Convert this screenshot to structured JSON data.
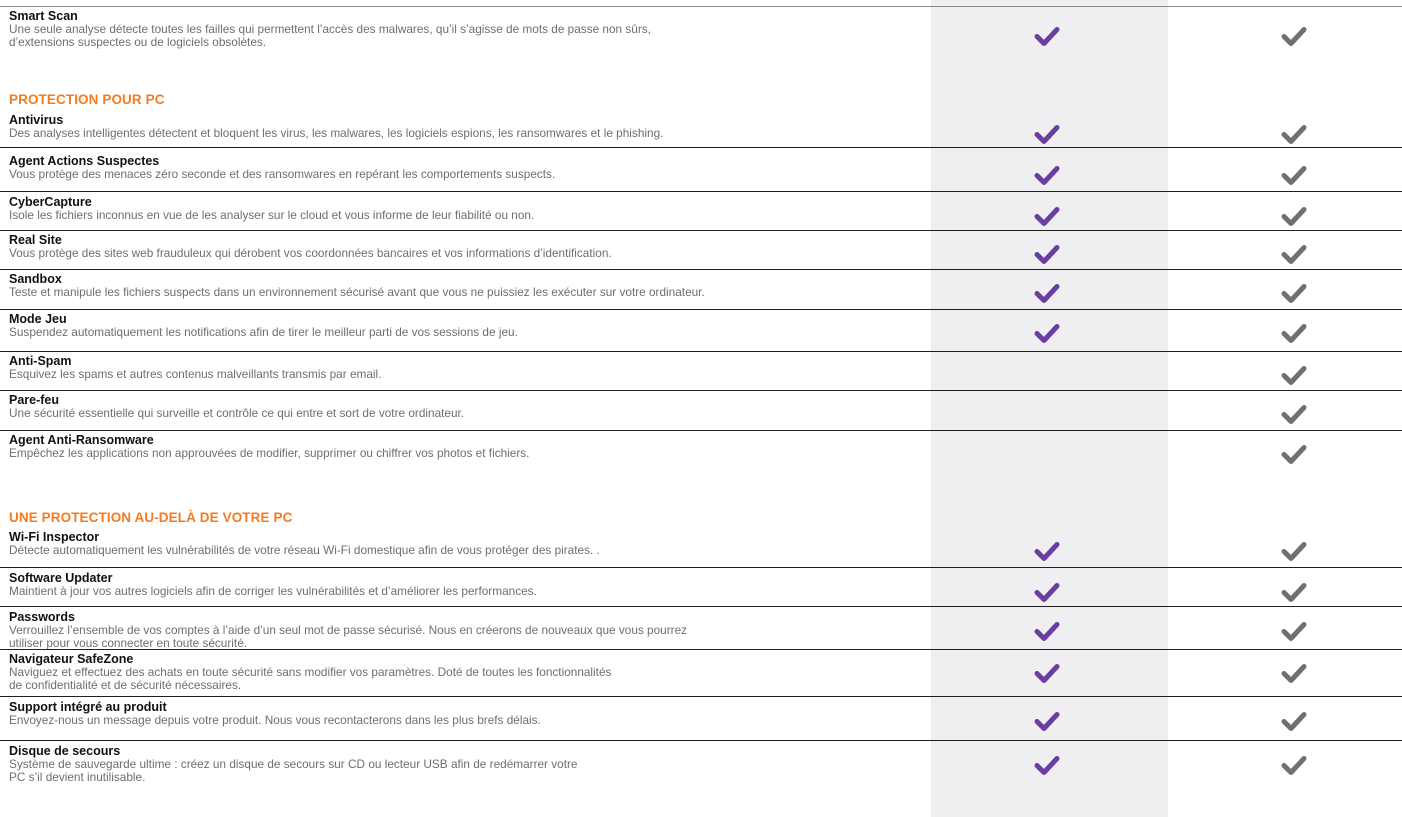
{
  "colors": {
    "heading": "#f47b20",
    "check_premium": "#6a3ea1",
    "check_internet": "#707074",
    "column_band": "#efeff1"
  },
  "icons": {
    "check": "check-icon"
  },
  "smart_scan": {
    "title": "Smart Scan",
    "desc": "Une seule analyse détecte toutes les failles qui permettent l’accès des malwares, qu’il s’agisse de mots de passe non sûrs,\nd’extensions suspectes ou de logiciels obsolètes.",
    "col1": true,
    "col2": true
  },
  "sections": [
    {
      "heading": "PROTECTION POUR PC",
      "features": [
        {
          "title": "Antivirus",
          "desc": "Des analyses intelligentes détectent et bloquent les virus, les malwares, les logiciels espions, les ransomwares et le phishing.",
          "col1": true,
          "col2": true
        },
        {
          "title": "Agent Actions Suspectes",
          "desc": "Vous protège des menaces zéro seconde et des ransomwares en repérant les comportements suspects.",
          "col1": true,
          "col2": true
        },
        {
          "title": "CyberCapture",
          "desc": "Isole les fichiers inconnus en vue de les analyser sur le cloud et vous informe de leur fiabilité ou non.",
          "col1": true,
          "col2": true
        },
        {
          "title": "Real Site",
          "desc": "Vous protège des sites web frauduleux qui dérobent vos coordonnées bancaires et vos informations d’identification.",
          "col1": true,
          "col2": true
        },
        {
          "title": "Sandbox",
          "desc": "Teste et manipule les fichiers suspects dans un environnement sécurisé avant que vous ne puissiez les exécuter sur votre ordinateur.",
          "col1": true,
          "col2": true
        },
        {
          "title": "Mode Jeu",
          "desc": "Suspendez automatiquement les notifications afin de tirer le meilleur parti de vos sessions de jeu.",
          "col1": true,
          "col2": true
        },
        {
          "title": "Anti-Spam",
          "desc": "Esquivez les spams et autres contenus malveillants transmis par email.",
          "col1": false,
          "col2": true
        },
        {
          "title": "Pare-feu",
          "desc": "Une sécurité essentielle qui surveille et contrôle ce qui entre et sort de votre ordinateur.",
          "col1": false,
          "col2": true
        },
        {
          "title": "Agent Anti-Ransomware",
          "desc": "Empêchez les applications non approuvées de modifier, supprimer ou chiffrer vos photos et fichiers.",
          "col1": false,
          "col2": true
        }
      ]
    },
    {
      "heading": "UNE PROTECTION AU-DELÀ DE VOTRE PC",
      "features": [
        {
          "title": "Wi-Fi Inspector",
          "desc": "Détecte automatiquement les vulnérabilités de votre réseau Wi-Fi domestique afin de vous protéger des pirates. .",
          "col1": true,
          "col2": true
        },
        {
          "title": "Software Updater",
          "desc": "Maintient à jour vos autres logiciels afin de corriger les vulnérabilités et d’améliorer les performances.",
          "col1": true,
          "col2": true
        },
        {
          "title": "Passwords",
          "desc": "Verrouillez l’ensemble de vos comptes à l’aide d’un seul mot de passe sécurisé. Nous en créerons de nouveaux que vous pourrez\nutiliser pour vous connecter en toute sécurité.",
          "col1": true,
          "col2": true
        },
        {
          "title": "Navigateur SafeZone",
          "desc": "Naviguez et effectuez des achats en toute sécurité sans modifier vos paramètres. Doté de toutes les fonctionnalités\nde confidentialité et de sécurité nécessaires.",
          "col1": true,
          "col2": true
        },
        {
          "title": "Support intégré au produit",
          "desc": "Envoyez-nous un message depuis votre produit. Nous vous recontacterons dans les plus brefs délais.",
          "col1": true,
          "col2": true
        },
        {
          "title": "Disque de secours",
          "desc": "Système de sauvegarde ultime : créez un disque de secours sur CD ou lecteur USB afin de redémarrer votre\nPC s’il devient inutilisable.",
          "col1": true,
          "col2": true
        }
      ]
    }
  ]
}
